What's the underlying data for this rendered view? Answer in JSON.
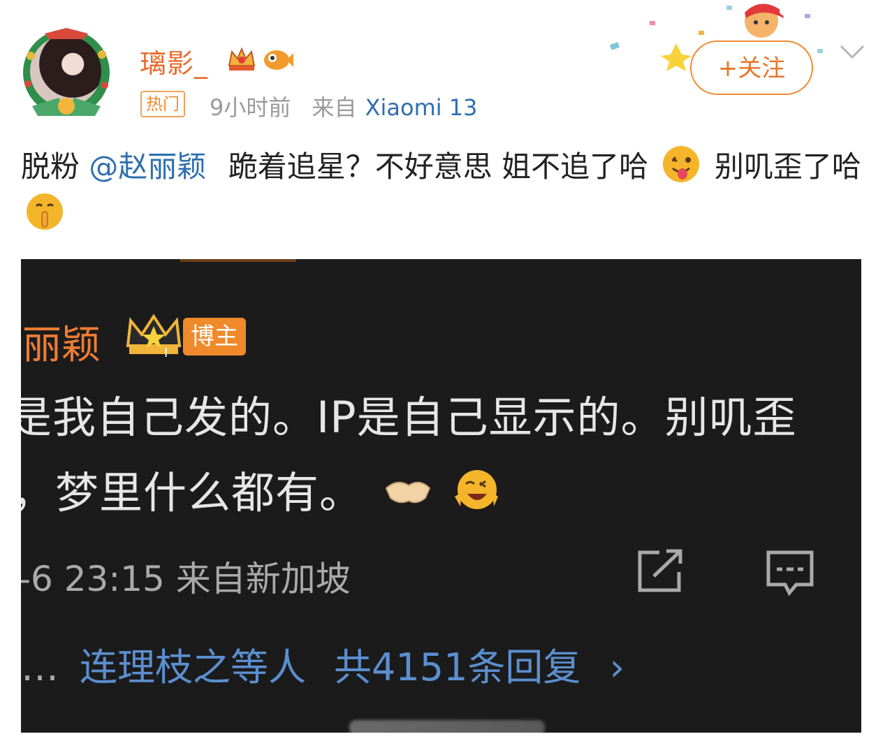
{
  "header": {
    "username": "璃影_",
    "hot_tag": "热门",
    "time": "9小时前",
    "source_prefix": "来自",
    "source_device": "Xiaomi 13",
    "follow_label": "+关注"
  },
  "post": {
    "prefix": "脱粉",
    "mention": "@赵丽颖",
    "text1": "跪着追星？不好意思 姐不追了哈",
    "text2": "别叽歪了哈"
  },
  "screenshot": {
    "name": "丽颖",
    "badge": "博主",
    "line1": "是我自己发的。IP是自己显示的。别叽歪",
    "line2": "，梦里什么都有。",
    "meta": "-6 23:15 来自新加坡",
    "dots": "…",
    "replies_users": "连理枝之等人",
    "replies_count": "共4151条回复",
    "replies_arrow": "›"
  },
  "icons": [
    "avatar-wreath",
    "crown-level-icon",
    "fish-badge-icon",
    "tongue-emoji",
    "shush-emoji",
    "handshake-emoji",
    "laugh-emoji",
    "share-icon",
    "comment-icon",
    "chevron-down-icon"
  ],
  "colors": {
    "accent": "#e86a2c",
    "link": "#2f6fae",
    "dark_bg": "#1b1b1b"
  }
}
